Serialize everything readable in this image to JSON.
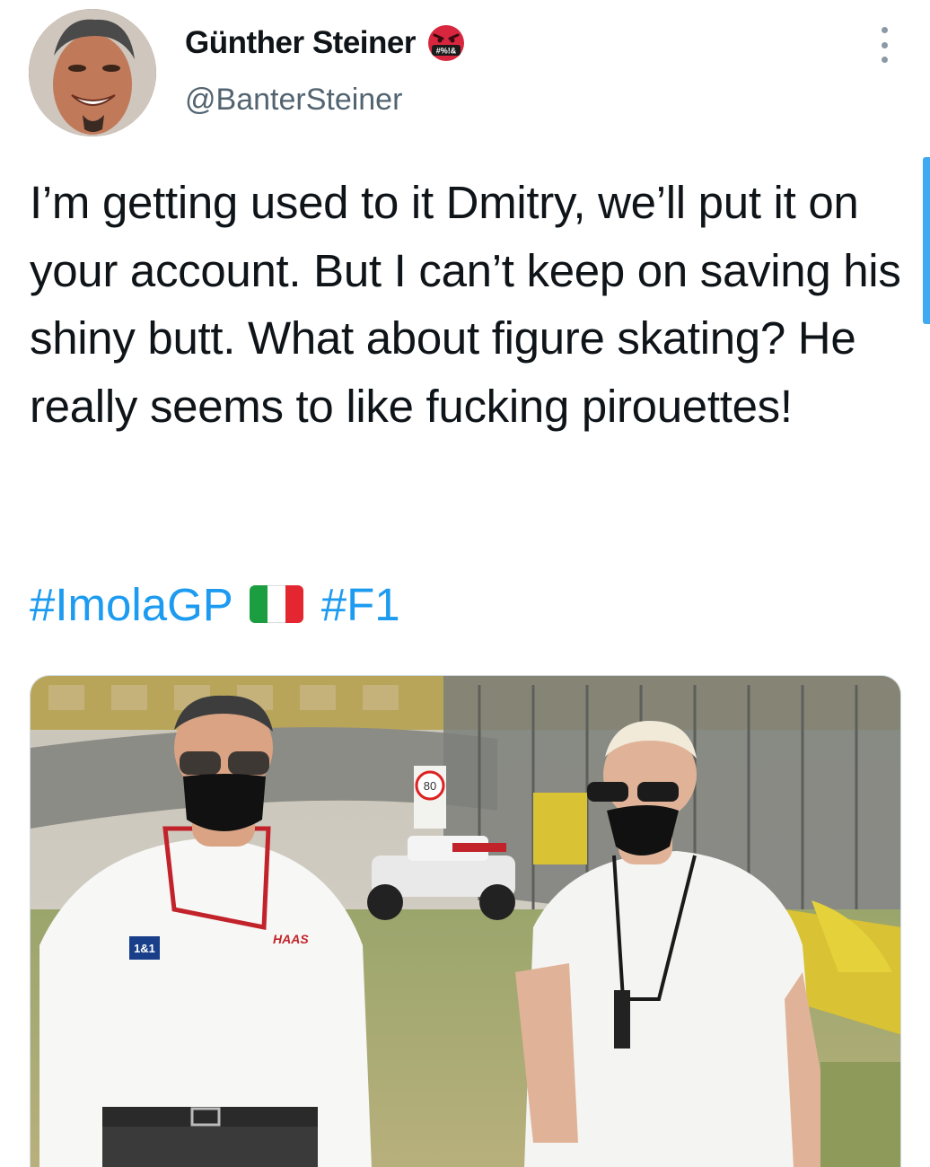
{
  "author": {
    "display_name": "Günther Steiner",
    "handle": "@BanterSteiner",
    "avatar_icon": "avatar-photo",
    "badge_icon": "angry-face-emoji",
    "badge_text": "#%!&"
  },
  "tweet": {
    "text": "I’m getting used to it Dmitry, we’ll put it on your account. But I can’t keep on saving his shiny butt. What about figure skating? He really seems to like fucking pirouettes!",
    "hashtag_1": "#ImolaGP",
    "hashtag_2": "#F1",
    "flag_icon": "italy-flag-emoji",
    "flag_colors": [
      "#1a9e3f",
      "#ffffff",
      "#e3262f"
    ]
  },
  "media": {
    "icon": "photo-media",
    "speed_sign": "80",
    "shirt_sponsor": "1&1",
    "shirt_brand": "HAAS"
  },
  "colors": {
    "link": "#1d9bf0",
    "text": "#0f1419",
    "secondary": "#536471"
  }
}
